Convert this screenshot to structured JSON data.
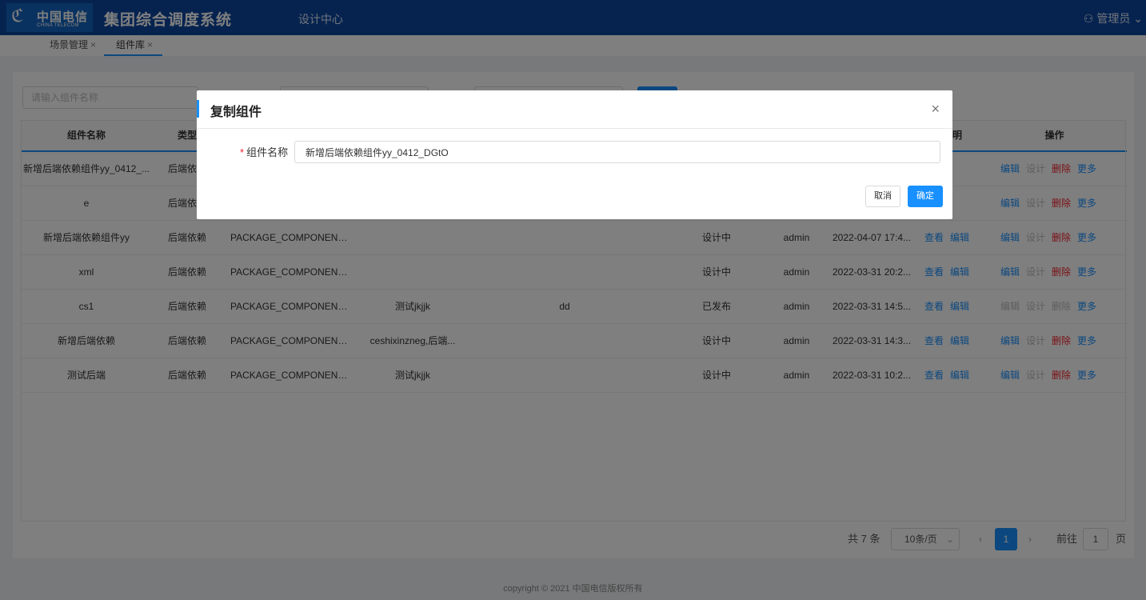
{
  "header": {
    "logo_cn": "中国电信",
    "logo_en": "CHINA TELECOM",
    "system_title": "集团综合调度系统",
    "nav_design": "设计中心",
    "user": "管理员"
  },
  "tabs": [
    {
      "label": "场景管理"
    },
    {
      "label": "组件库"
    }
  ],
  "search": {
    "placeholder": "请输入组件名称"
  },
  "table": {
    "columns": [
      "组件名称",
      "类型",
      "",
      "",
      "",
      "",
      "",
      "",
      "说明",
      "操作"
    ],
    "rows": [
      {
        "name": "新增后端依赖组件yy_0412_...",
        "type": "后端依赖",
        "code": "",
        "desc": "",
        "tag": "",
        "status": "",
        "user": "",
        "time": "",
        "ops": [
          "编辑",
          "设计",
          "删除",
          "更多"
        ]
      },
      {
        "name": "e",
        "type": "后端依赖",
        "code": "",
        "desc": "",
        "tag": "",
        "status": "",
        "user": "",
        "time": "",
        "ops": [
          "编辑",
          "设计",
          "删除",
          "更多"
        ]
      },
      {
        "name": "新增后端依赖组件yy",
        "type": "后端依赖",
        "code": "PACKAGE_COMPONENT...",
        "desc": "",
        "tag": "",
        "status": "设计中",
        "user": "admin",
        "time": "2022-04-07 17:4...",
        "links": [
          "查看",
          "编辑"
        ],
        "ops": [
          "编辑",
          "设计",
          "删除",
          "更多"
        ]
      },
      {
        "name": "xml",
        "type": "后端依赖",
        "code": "PACKAGE_COMPONENT...",
        "desc": "",
        "tag": "",
        "status": "设计中",
        "user": "admin",
        "time": "2022-03-31 20:2...",
        "links": [
          "查看",
          "编辑"
        ],
        "ops": [
          "编辑",
          "设计",
          "删除",
          "更多"
        ]
      },
      {
        "name": "cs1",
        "type": "后端依赖",
        "code": "PACKAGE_COMPONENT...",
        "desc": "测试jkjjk",
        "tag": "dd",
        "status": "已发布",
        "user": "admin",
        "time": "2022-03-31 14:5...",
        "links": [
          "查看",
          "编辑"
        ],
        "ops": [
          "编辑",
          "设计",
          "删除",
          "更多"
        ]
      },
      {
        "name": "新增后端依赖",
        "type": "后端依赖",
        "code": "PACKAGE_COMPONENT...",
        "desc": "ceshixinzneg,后端...",
        "tag": "",
        "status": "设计中",
        "user": "admin",
        "time": "2022-03-31 14:3...",
        "links": [
          "查看",
          "编辑"
        ],
        "ops": [
          "编辑",
          "设计",
          "删除",
          "更多"
        ]
      },
      {
        "name": "测试后端",
        "type": "后端依赖",
        "code": "PACKAGE_COMPONENT...",
        "desc": "测试jkjjk",
        "tag": "",
        "status": "设计中",
        "user": "admin",
        "time": "2022-03-31 10:2...",
        "links": [
          "查看",
          "编辑"
        ],
        "ops": [
          "编辑",
          "设计",
          "删除",
          "更多"
        ]
      }
    ]
  },
  "pagination": {
    "total": "共 7 条",
    "page_size": "10条/页",
    "prev": "‹",
    "current": "1",
    "next": "›",
    "jump_prefix": "前往",
    "jump_value": "1",
    "jump_suffix": "页"
  },
  "footer": {
    "copyright": "copyright © 2021 中国电信版权所有"
  },
  "modal": {
    "title": "复制组件",
    "close": "×",
    "field_required_mark": "*",
    "field_label": "组件名称",
    "field_value": "新增后端依赖组件yy_0412_DGtO",
    "cancel": "取消",
    "confirm": "确定"
  }
}
